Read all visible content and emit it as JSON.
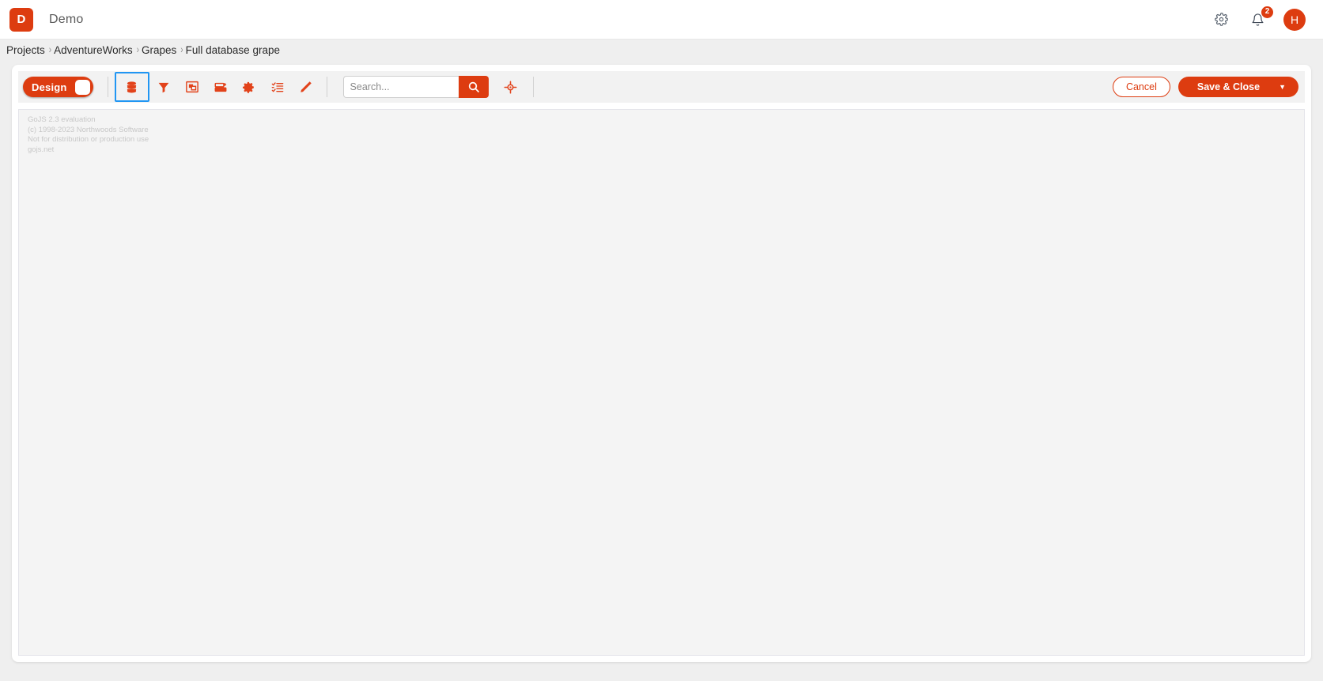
{
  "appbar": {
    "logo_letter": "D",
    "title": "Demo",
    "settings_icon": "gear-icon",
    "notifications_icon": "bell-icon",
    "notifications_count": "2",
    "avatar_letter": "H"
  },
  "breadcrumb": {
    "separator": "›",
    "items": [
      {
        "label": "Projects"
      },
      {
        "label": "AdventureWorks"
      },
      {
        "label": "Grapes"
      },
      {
        "label": "Full database grape"
      }
    ]
  },
  "toolbar": {
    "design_toggle": {
      "label": "Design",
      "state": "on"
    },
    "tools": [
      {
        "name": "database-icon",
        "title": "Database",
        "active": true
      },
      {
        "name": "filter-icon",
        "title": "Filter",
        "active": false
      },
      {
        "name": "fit-to-screen-icon",
        "title": "Fit to screen",
        "active": false
      },
      {
        "name": "layout-icon",
        "title": "Layout",
        "active": false
      },
      {
        "name": "gear-icon",
        "title": "Settings",
        "active": false
      },
      {
        "name": "checklist-icon",
        "title": "Checklist",
        "active": false
      },
      {
        "name": "pencil-icon",
        "title": "Edit",
        "active": false
      }
    ],
    "search": {
      "placeholder": "Search...",
      "value": "",
      "button_icon": "search-icon"
    },
    "locate_icon": "crosshair-target-icon",
    "cancel_label": "Cancel",
    "save_label": "Save & Close",
    "save_caret": "▼"
  },
  "canvas": {
    "watermark": [
      "GoJS 2.3 evaluation",
      "(c) 1998-2023 Northwoods Software",
      "Not for distribution or production use",
      "gojs.net"
    ]
  },
  "colors": {
    "brand": "#dd3c10",
    "tool_icon": "#dd4a1c",
    "focus_ring": "#2196f3",
    "page_bg": "#efefef",
    "toolbar_bg": "#f2f2f2",
    "canvas_bg": "#f4f4f4"
  }
}
